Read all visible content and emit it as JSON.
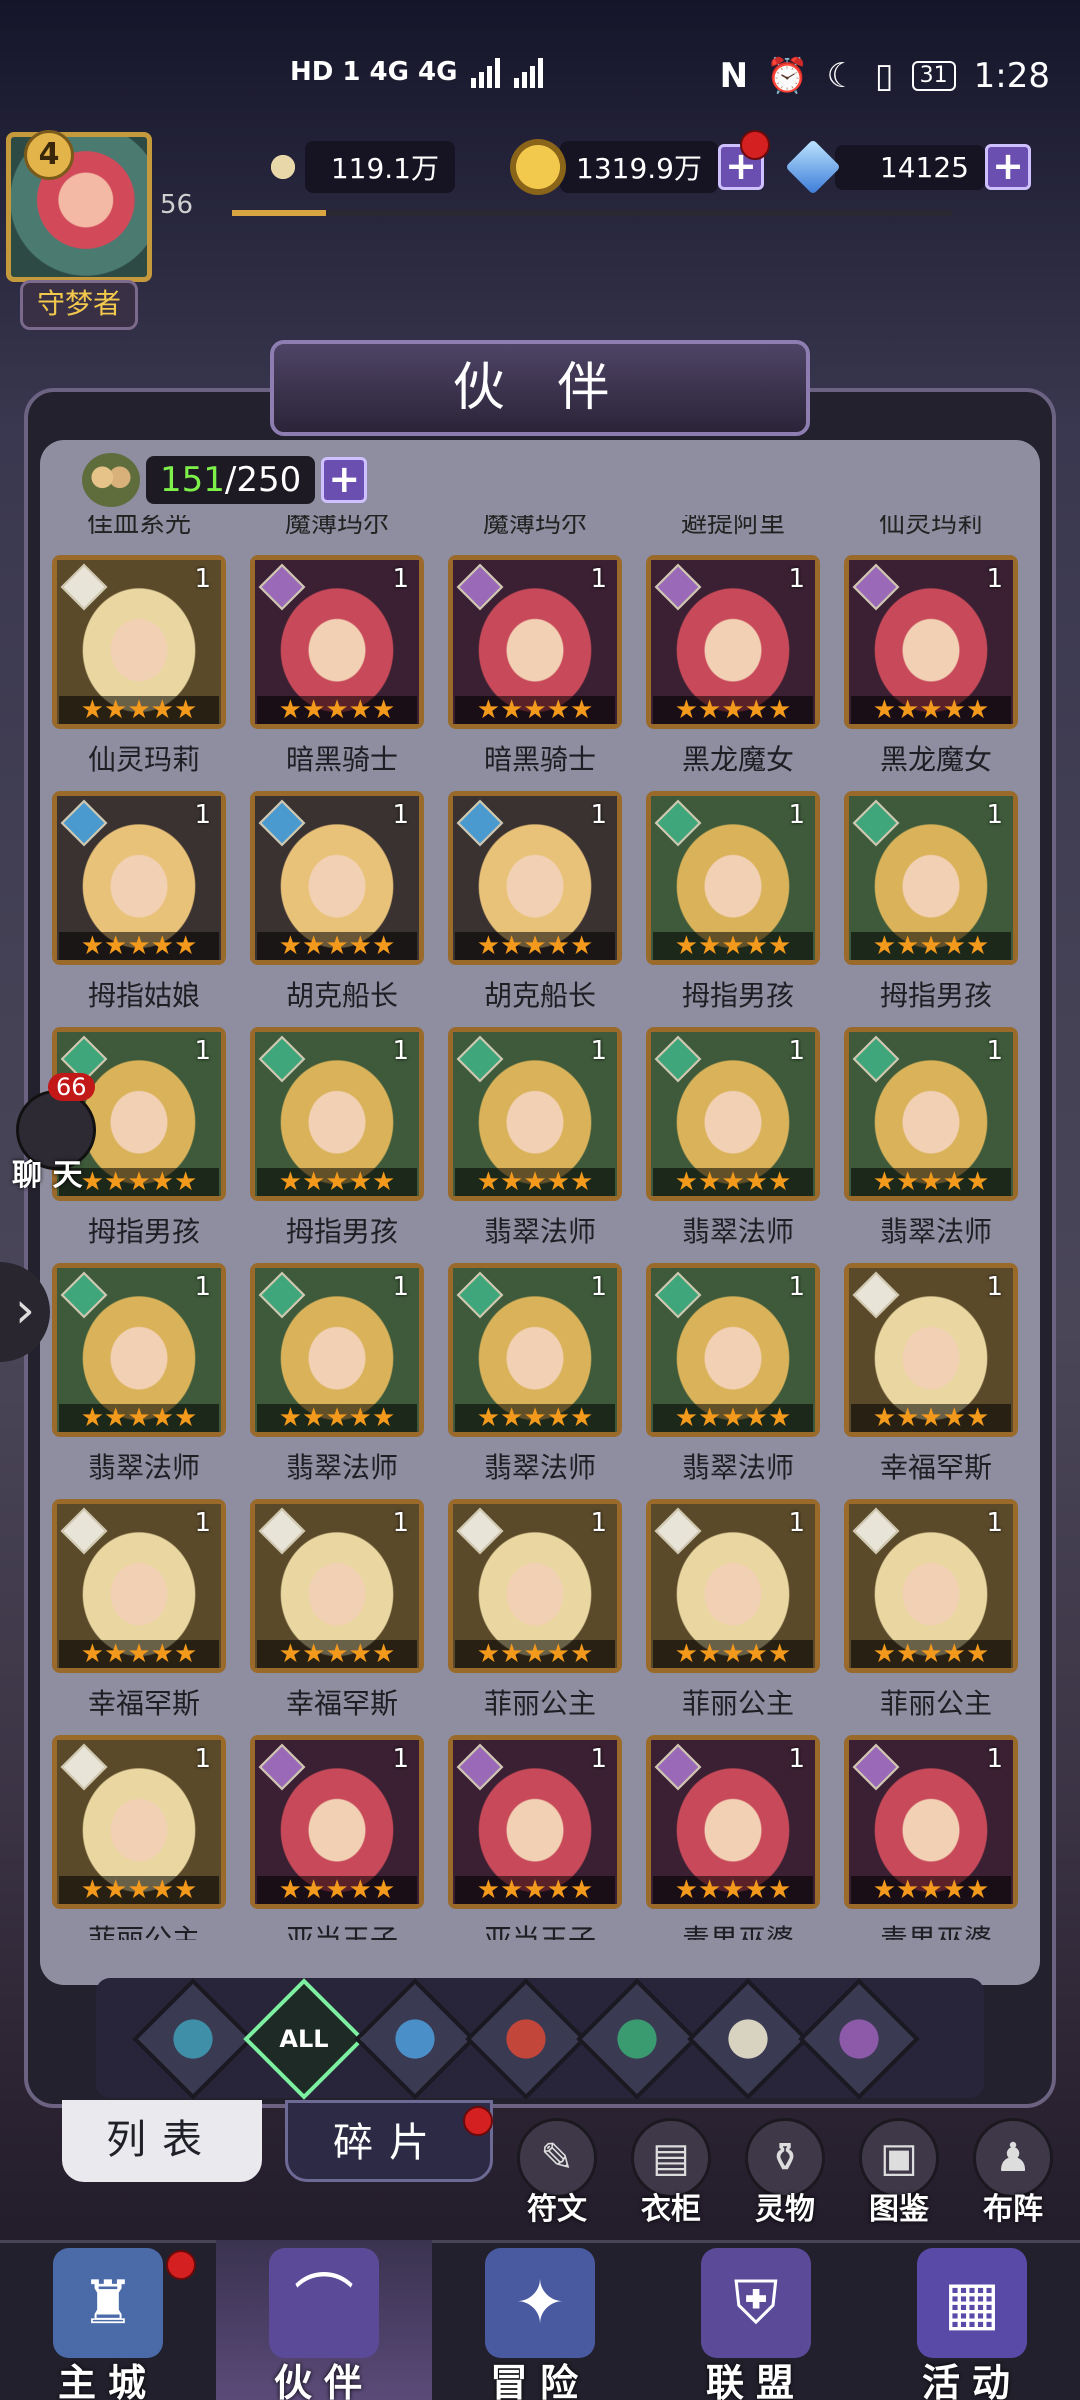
{
  "status_bar": {
    "left_indicators": "HD 1  4G  4G",
    "nfc": "N",
    "battery": "31",
    "time": "1:28"
  },
  "player": {
    "level": "4",
    "exp_value": "56",
    "title": "守梦者",
    "exp_fraction": 0.13
  },
  "currencies": {
    "power": "119.1万",
    "gold": "1319.9万",
    "gems": "14125"
  },
  "page_title": "伙 伴",
  "roster": {
    "owned": "151",
    "capacity": "/250"
  },
  "cut_off_top_names": [
    "佳血系光",
    "魔薄玛尔",
    "魔薄玛尔",
    "避提阿里",
    "仙灵玛莉"
  ],
  "heroes": [
    {
      "name": "仙灵玛莉",
      "count": "1",
      "stars": "★★★★★",
      "element": "light"
    },
    {
      "name": "暗黑骑士",
      "count": "1",
      "stars": "★★★★★",
      "element": "dark"
    },
    {
      "name": "暗黑骑士",
      "count": "1",
      "stars": "★★★★★",
      "element": "dark"
    },
    {
      "name": "黑龙魔女",
      "count": "1",
      "stars": "★★★★★",
      "element": "dark"
    },
    {
      "name": "黑龙魔女",
      "count": "1",
      "stars": "★★★★★",
      "element": "dark"
    },
    {
      "name": "拇指姑娘",
      "count": "1",
      "stars": "★★★★★",
      "element": "water"
    },
    {
      "name": "胡克船长",
      "count": "1",
      "stars": "★★★★★",
      "element": "water"
    },
    {
      "name": "胡克船长",
      "count": "1",
      "stars": "★★★★★",
      "element": "water"
    },
    {
      "name": "拇指男孩",
      "count": "1",
      "stars": "★★★★★",
      "element": "wind"
    },
    {
      "name": "拇指男孩",
      "count": "1",
      "stars": "★★★★★",
      "element": "wind"
    },
    {
      "name": "拇指男孩",
      "count": "1",
      "stars": "★★★★★",
      "element": "wind"
    },
    {
      "name": "拇指男孩",
      "count": "1",
      "stars": "★★★★★",
      "element": "wind"
    },
    {
      "name": "翡翠法师",
      "count": "1",
      "stars": "★★★★★",
      "element": "wind"
    },
    {
      "name": "翡翠法师",
      "count": "1",
      "stars": "★★★★★",
      "element": "wind"
    },
    {
      "name": "翡翠法师",
      "count": "1",
      "stars": "★★★★★",
      "element": "wind"
    },
    {
      "name": "翡翠法师",
      "count": "1",
      "stars": "★★★★★",
      "element": "wind"
    },
    {
      "name": "翡翠法师",
      "count": "1",
      "stars": "★★★★★",
      "element": "wind"
    },
    {
      "name": "翡翠法师",
      "count": "1",
      "stars": "★★★★★",
      "element": "wind"
    },
    {
      "name": "翡翠法师",
      "count": "1",
      "stars": "★★★★★",
      "element": "wind"
    },
    {
      "name": "幸福罕斯",
      "count": "1",
      "stars": "★★★★★",
      "element": "light"
    },
    {
      "name": "幸福罕斯",
      "count": "1",
      "stars": "★★★★★",
      "element": "light"
    },
    {
      "name": "幸福罕斯",
      "count": "1",
      "stars": "★★★★★",
      "element": "light"
    },
    {
      "name": "菲丽公主",
      "count": "1",
      "stars": "★★★★★",
      "element": "light"
    },
    {
      "name": "菲丽公主",
      "count": "1",
      "stars": "★★★★★",
      "element": "light"
    },
    {
      "name": "菲丽公主",
      "count": "1",
      "stars": "★★★★★",
      "element": "light"
    },
    {
      "name": "菲丽公主",
      "count": "1",
      "stars": "★★★★★",
      "element": "light"
    },
    {
      "name": "亚当王子",
      "count": "1",
      "stars": "★★★★★",
      "element": "dark"
    },
    {
      "name": "亚当王子",
      "count": "1",
      "stars": "★★★★★",
      "element": "dark"
    },
    {
      "name": "毒果巫婆",
      "count": "1",
      "stars": "★★★★★",
      "element": "dark"
    },
    {
      "name": "毒果巫婆",
      "count": "1",
      "stars": "★★★★★",
      "element": "dark"
    }
  ],
  "element_colors": {
    "light": "#e8e4d8",
    "dark": "#9a6ab8",
    "water": "#4a9ad0",
    "wind": "#3fa57a"
  },
  "filters": [
    {
      "id": "shadow",
      "label": "",
      "color": "#3f8fa8"
    },
    {
      "id": "all",
      "label": "ALL",
      "color": "#2e8a5a"
    },
    {
      "id": "water",
      "label": "",
      "color": "#4a8fc8"
    },
    {
      "id": "fire",
      "label": "",
      "color": "#c2463a"
    },
    {
      "id": "wind",
      "label": "",
      "color": "#3a9a70"
    },
    {
      "id": "light",
      "label": "",
      "color": "#d8d2c0"
    },
    {
      "id": "dark",
      "label": "",
      "color": "#8c5aa8"
    }
  ],
  "chat": {
    "badge": "66",
    "label": "聊 天"
  },
  "tabs": {
    "list": "列表",
    "fragments": "碎片"
  },
  "side_buttons": [
    "符文",
    "衣柜",
    "灵物",
    "图鉴",
    "布阵"
  ],
  "nav": [
    "主城",
    "伙伴",
    "冒险",
    "联盟",
    "活动"
  ]
}
